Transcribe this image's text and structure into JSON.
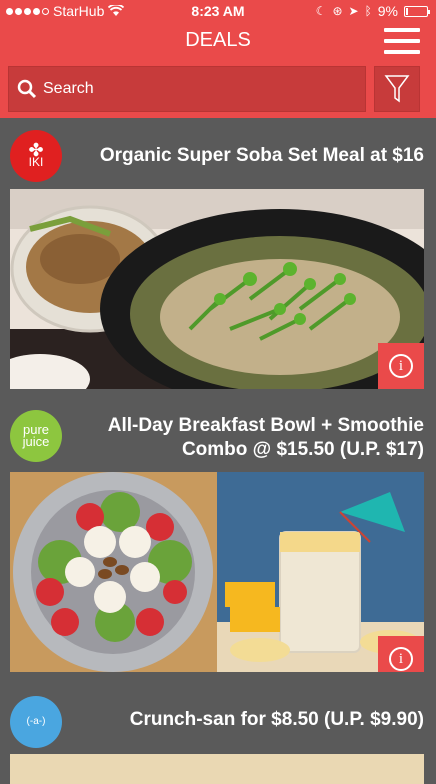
{
  "status_bar": {
    "carrier": "StarHub",
    "time": "8:23 AM",
    "battery": "9%"
  },
  "nav": {
    "title": "DEALS"
  },
  "search": {
    "label": "Search"
  },
  "deals": [
    {
      "title": "Organic Super Soba Set Meal at $16",
      "logo_text": "IKI"
    },
    {
      "title": "All-Day Breakfast Bowl + Smoothie Combo @ $15.50 (U.P. $17)",
      "logo_text_1": "pure",
      "logo_text_2": "juice"
    },
    {
      "title": "Crunch-san for $8.50 (U.P. $9.90)",
      "logo_text": "(-a-)"
    }
  ],
  "colors": {
    "accent": "#ea4a4a",
    "background": "#5a5a5a"
  }
}
